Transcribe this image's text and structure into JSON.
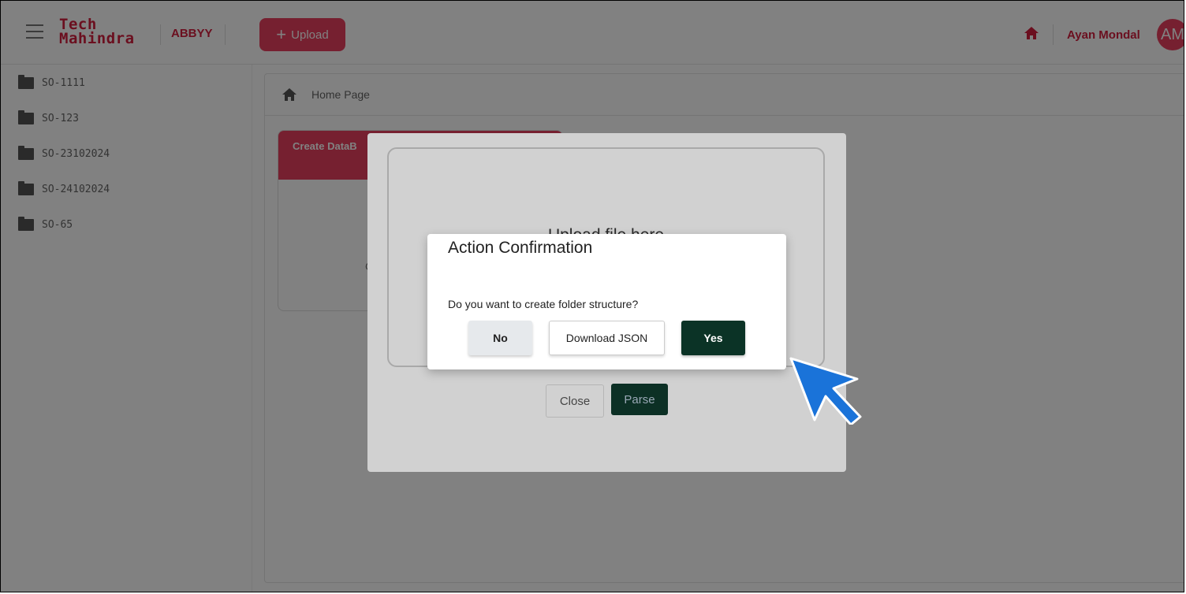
{
  "header": {
    "logo_line1": "Tech",
    "logo_line2": "Mahindra",
    "product": "ABBYY",
    "upload_label": "Upload",
    "user_name": "Ayan Mondal",
    "avatar_initials": "AM",
    "brand_color": "#e8415f"
  },
  "sidebar": {
    "items": [
      {
        "label": "SO-1111"
      },
      {
        "label": "SO-123"
      },
      {
        "label": "SO-23102024"
      },
      {
        "label": "SO-24102024"
      },
      {
        "label": "SO-65"
      }
    ]
  },
  "breadcrumb": {
    "label": "Home Page"
  },
  "card": {
    "title": "Create DataB",
    "partial_text": "C"
  },
  "upload_modal": {
    "drop_text": "Upload file here",
    "close_label": "Close",
    "parse_label": "Parse"
  },
  "dialog": {
    "title": "Action Confirmation",
    "message": "Do you want to create folder structure?",
    "no_label": "No",
    "download_label": "Download JSON",
    "yes_label": "Yes",
    "yes_color": "#0b3326"
  },
  "cursor": {
    "icon": "pointer-arrow-icon",
    "color": "#1a73d9"
  }
}
